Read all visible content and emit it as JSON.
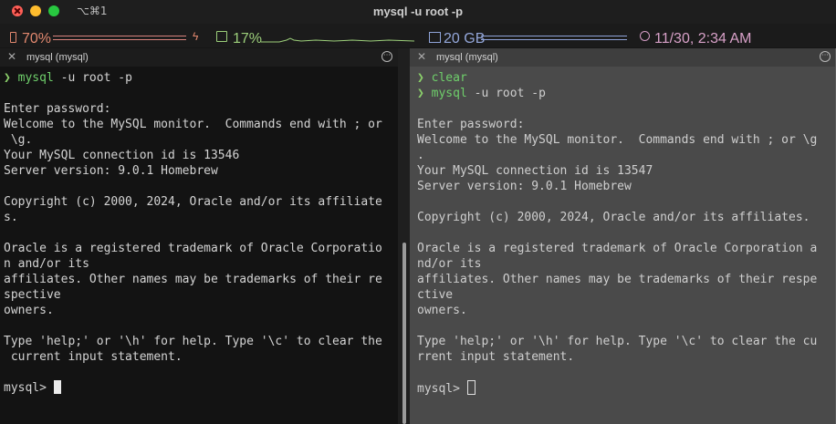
{
  "window": {
    "title": "mysql -u root -p",
    "shortcut": "⌥⌘1"
  },
  "status_bar": {
    "battery": "70%",
    "cpu": "17%",
    "disk": "20 GB",
    "datetime": "11/30, 2:34 AM",
    "colors": {
      "battery": "#e2886f",
      "cpu": "#9ccf7a",
      "disk": "#93a6d9",
      "clock": "#d7a0c7"
    }
  },
  "panes": [
    {
      "tab_label": "mysql (mysql)",
      "close_glyph": "✕",
      "menu_glyph": "···",
      "commands": [
        {
          "arrow": "❯",
          "cmd": "mysql",
          "args": " -u root -p"
        }
      ],
      "output": [
        "",
        "Enter password:",
        "Welcome to the MySQL monitor.  Commands end with ; or",
        " \\g.",
        "Your MySQL connection id is 13546",
        "Server version: 9.0.1 Homebrew",
        "",
        "Copyright (c) 2000, 2024, Oracle and/or its affiliate",
        "s.",
        "",
        "Oracle is a registered trademark of Oracle Corporatio",
        "n and/or its",
        "affiliates. Other names may be trademarks of their re",
        "spective",
        "owners.",
        "",
        "Type 'help;' or '\\h' for help. Type '\\c' to clear the",
        " current input statement.",
        ""
      ],
      "prompt": "mysql> "
    },
    {
      "tab_label": "mysql (mysql)",
      "close_glyph": "✕",
      "menu_glyph": "···",
      "commands": [
        {
          "arrow": "❯",
          "cmd": "clear",
          "args": ""
        },
        {
          "arrow": "❯",
          "cmd": "mysql",
          "args": " -u root -p"
        }
      ],
      "output": [
        "",
        "Enter password:",
        "Welcome to the MySQL monitor.  Commands end with ; or \\g",
        ".",
        "Your MySQL connection id is 13547",
        "Server version: 9.0.1 Homebrew",
        "",
        "Copyright (c) 2000, 2024, Oracle and/or its affiliates.",
        "",
        "Oracle is a registered trademark of Oracle Corporation a",
        "nd/or its",
        "affiliates. Other names may be trademarks of their respe",
        "ctive",
        "owners.",
        "",
        "Type 'help;' or '\\h' for help. Type '\\c' to clear the cu",
        "rrent input statement.",
        ""
      ],
      "prompt": "mysql> "
    }
  ]
}
